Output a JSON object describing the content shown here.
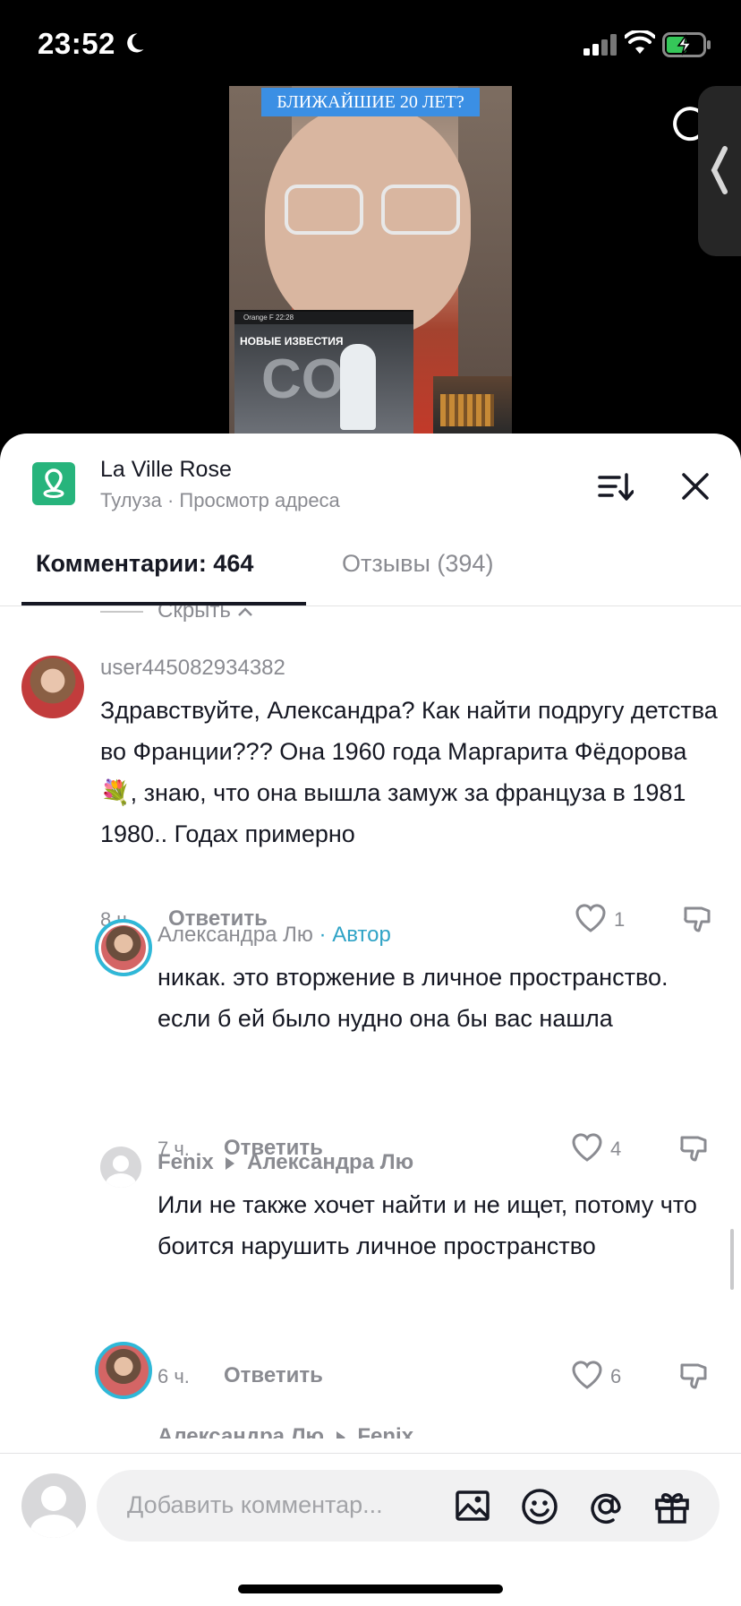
{
  "status": {
    "time": "23:52"
  },
  "video": {
    "caption": "БЛИЖАЙШИЕ 20 ЛЕТ?",
    "inset_bar": "Orange F 22:28",
    "inset_logo": "НОВЫЕ ИЗВЕСТИЯ",
    "inset_big": "CO"
  },
  "place": {
    "name": "La Ville Rose",
    "subtitle": "Тулуза · Просмотр адреса"
  },
  "tabs": [
    {
      "label": "Комментарии: 464",
      "active": true
    },
    {
      "label": "Отзывы (394)",
      "active": false
    }
  ],
  "hide_label": "Скрыть",
  "comments": [
    {
      "user": "user445082934382",
      "text": "Здравствуйте, Александра? Как найти подругу детства во Франции??? Она 1960 года Маргарита Фёдорова💐, знаю, что она вышла замуж за француза в 1981 1980.. Годах примерно",
      "time": "8 ч.",
      "reply": "Ответить",
      "likes": "1"
    },
    {
      "user": "Александра Лю",
      "author_tag": "· Автор",
      "text": "никак. это вторжение в личное пространство. если б ей было нудно она бы вас нашла",
      "time": "7 ч.",
      "reply": "Ответить",
      "likes": "4"
    },
    {
      "user": "Fenix",
      "reply_to": "Александра Лю",
      "text": "Или не также хочет найти и не ищет, потому что боится нарушить личное пространство",
      "time": "6 ч.",
      "reply": "Ответить",
      "likes": "6"
    },
    {
      "user": "Александра Лю",
      "reply_to": "Fenix"
    }
  ],
  "composer": {
    "placeholder": "Добавить комментар..."
  },
  "colors": {
    "accent": "#2fa3c6",
    "place_icon": "#27b47c"
  }
}
